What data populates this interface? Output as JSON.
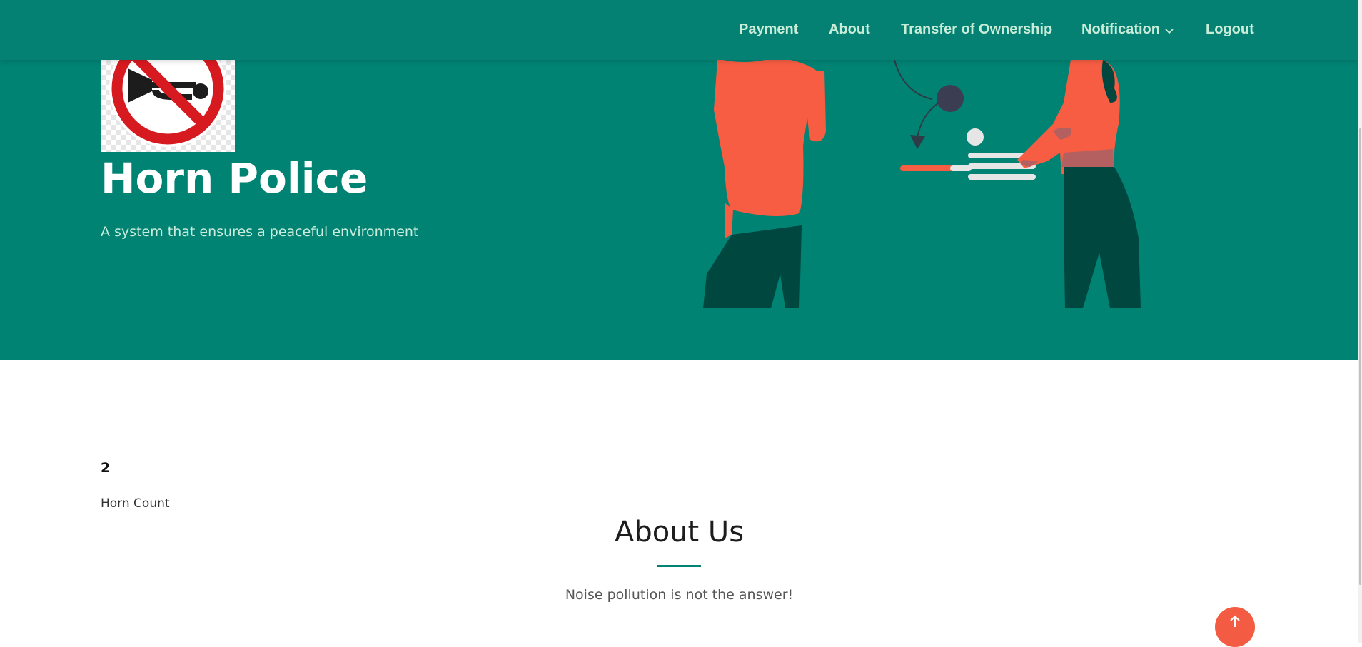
{
  "nav": {
    "items": [
      {
        "label": "Payment"
      },
      {
        "label": "About"
      },
      {
        "label": "Transfer of Ownership"
      },
      {
        "label": "Notification"
      },
      {
        "label": "Logout"
      }
    ]
  },
  "hero": {
    "logo_icon": "no-horn-sign-icon",
    "title": "Horn Police",
    "subtitle": "A system that ensures a peaceful environment",
    "illustration": "two-people-exchange-illustration"
  },
  "stats": {
    "horn_count_value": "2",
    "horn_count_label": "Horn Count"
  },
  "about": {
    "title": "About Us",
    "subtitle": "Noise pollution is not the answer!"
  },
  "colors": {
    "brand": "#018374",
    "accent": "#f35b42",
    "nav_text": "#c9ecd9"
  },
  "icons": {
    "back_to_top": "arrow-up-icon",
    "dropdown": "chevron-down-icon"
  }
}
